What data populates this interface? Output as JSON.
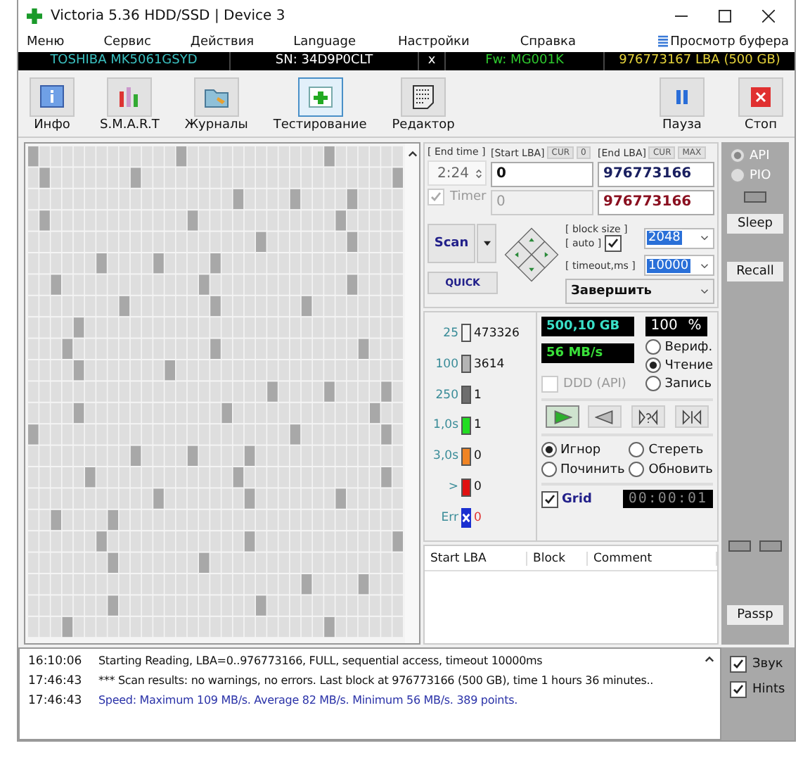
{
  "window": {
    "title": "Victoria 5.36 HDD/SSD | Device 3"
  },
  "menu": [
    "Меню",
    "Сервис",
    "Действия",
    "Language",
    "Настройки",
    "Справка"
  ],
  "buffer_button": "Просмотр буфера",
  "drive_bar": {
    "model": "TOSHIBA MK5061GSYD",
    "serial": "SN: 34D9P0CLT",
    "close": "x",
    "firmware": "Fw: MG001K",
    "capacity": "976773167 LBA (500 GB)"
  },
  "toolbar": [
    {
      "label": "Инфо",
      "kind": "info",
      "selected": false
    },
    {
      "label": "S.M.A.R.T",
      "kind": "smart",
      "selected": false
    },
    {
      "label": "Журналы",
      "kind": "folder",
      "selected": false
    },
    {
      "label": "Тестирование",
      "kind": "test",
      "selected": true
    },
    {
      "label": "Редактор",
      "kind": "editor",
      "selected": false
    }
  ],
  "right_toolbar": [
    {
      "label": "Пауза",
      "kind": "pause"
    },
    {
      "label": "Стоп",
      "kind": "stop"
    }
  ],
  "scan": {
    "end_time_label": "[ End time ]",
    "end_time": "2:24",
    "timer_label": "Timer",
    "timer_checked": true,
    "start_lba_label": "[Start LBA]",
    "cur_label": "CUR",
    "cur_value": "0",
    "start_lba": "0",
    "start_lba_2": "0",
    "end_lba_label": "[End LBA]",
    "end_cur_label": "CUR",
    "max_label": "MAX",
    "end_lba": "976773166",
    "end_lba_2": "976773166",
    "scan_button": "Scan",
    "quick_button": "QUICK",
    "block_size_label": "[ block size ]",
    "auto_label": "[ auto ]",
    "auto_checked": true,
    "block_size": "2048",
    "timeout_label": "[ timeout,ms ]",
    "timeout": "10000",
    "action": "Завершить"
  },
  "stats": [
    {
      "kind": "block",
      "label": "25",
      "color": "#f4f4f4",
      "count": "473326"
    },
    {
      "kind": "block",
      "label": "100",
      "color": "#b4b4b4",
      "count": "3614"
    },
    {
      "kind": "block",
      "label": "250",
      "color": "#6e6e6e",
      "count": "1"
    },
    {
      "kind": "block",
      "label": "1,0s",
      "color": "#22dd22",
      "count": "1"
    },
    {
      "kind": "block",
      "label": "3,0s",
      "color": "#f08424",
      "count": "0"
    },
    {
      "kind": "block",
      "label": ">",
      "color": "#e01010",
      "count": "0"
    },
    {
      "kind": "error",
      "label": "Err",
      "color": "#1a2fd0",
      "count": "0"
    }
  ],
  "readouts": {
    "size": "500,10 GB",
    "percent": "100",
    "percent_unit": "%",
    "speed": "56 MB/s"
  },
  "ddd": {
    "label": "DDD (API)",
    "checked": false
  },
  "mode_options": [
    {
      "label": "Вериф.",
      "selected": false
    },
    {
      "label": "Чтение",
      "selected": true
    },
    {
      "label": "Запись",
      "selected": false
    }
  ],
  "direction_buttons": [
    {
      "kind": "forward",
      "selected": true
    },
    {
      "kind": "backward",
      "selected": false
    },
    {
      "kind": "random",
      "selected": false
    },
    {
      "kind": "butterfly",
      "selected": false
    }
  ],
  "repair_options": [
    {
      "label": "Игнор",
      "selected": true
    },
    {
      "label": "Стереть",
      "selected": false
    },
    {
      "label": "Починить",
      "selected": false
    },
    {
      "label": "Обновить",
      "selected": false
    }
  ],
  "grid": {
    "label": "Grid",
    "checked": true,
    "timer": "00:00:01"
  },
  "defects_table": {
    "columns": [
      "Start LBA",
      "Block",
      "Comment"
    ]
  },
  "side_panel": {
    "options": [
      {
        "label": "API",
        "selected": true
      },
      {
        "label": "PIO",
        "selected": false
      }
    ],
    "buttons": [
      "Sleep",
      "Recall",
      "Passp"
    ]
  },
  "log": [
    {
      "time": "16:10:06",
      "text": "Starting Reading, LBA=0..976773166, FULL, sequential access, timeout 10000ms",
      "kind": "info"
    },
    {
      "time": "17:46:43",
      "text": "*** Scan results: no warnings, no errors. Last block at 976773166 (500 GB), time 1 hours 36 minutes..",
      "kind": "info"
    },
    {
      "time": "17:46:43",
      "text": "Speed: Maximum 109 MB/s. Average 82 MB/s. Minimum 56 MB/s. 389 points.",
      "kind": "speed"
    }
  ],
  "log_options": [
    {
      "label": "Звук",
      "checked": true
    },
    {
      "label": "Hints",
      "checked": true
    }
  ]
}
